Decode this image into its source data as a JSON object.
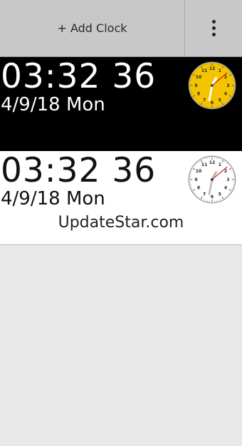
{
  "toolbar": {
    "add_clock_label": "+ Add Clock",
    "menu_icon": "more-vert-icon"
  },
  "clocks": [
    {
      "time": "03:32 36",
      "date": "4/9/18 Mon",
      "face_color": "#f5c400",
      "background": "#000000"
    },
    {
      "time": "03:32 36",
      "date": "4/9/18 Mon",
      "face_color": "#ffffff",
      "background": "#ffffff"
    }
  ],
  "footer": {
    "text": "UpdateStar.com"
  }
}
